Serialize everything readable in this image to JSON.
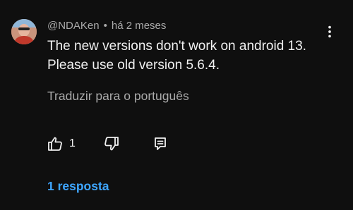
{
  "comment": {
    "author": "@NDAKen",
    "separator": "•",
    "time": "há 2 meses",
    "text_lines": [
      "The new versions don't work on android 13.",
      "Please use old version 5.6.4."
    ],
    "translate_label": "Traduzir para o português",
    "likes": "1",
    "replies_label": "1 resposta"
  },
  "icons": {
    "avatar": "avatar",
    "more": "more-vert-icon",
    "like": "thumb-up-icon",
    "dislike": "thumb-down-icon",
    "reply": "reply-icon"
  },
  "colors": {
    "background": "#0f0f0f",
    "primary_text": "#f1f1f1",
    "secondary_text": "#aaaaaa",
    "link": "#3ea6ff"
  }
}
